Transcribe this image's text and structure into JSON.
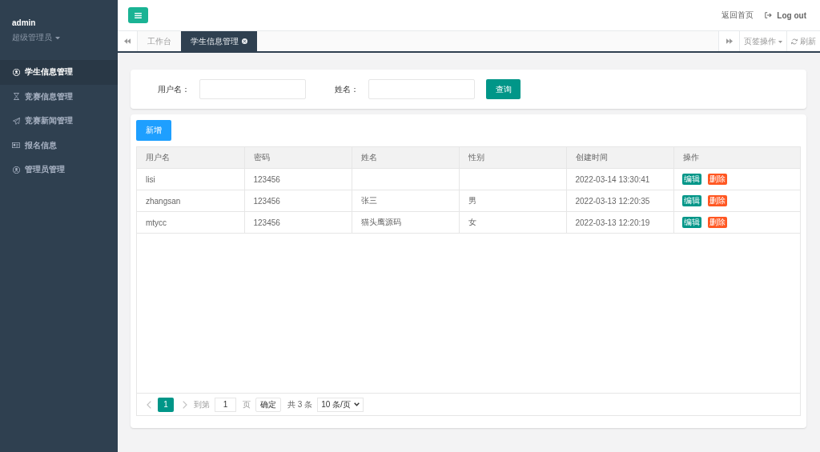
{
  "sidebar": {
    "user_name": "admin",
    "role": "超级管理员",
    "menu": [
      {
        "label": "学生信息管理",
        "selected": true
      },
      {
        "label": "竞赛信息管理",
        "selected": false
      },
      {
        "label": "竞赛新闻管理",
        "selected": false
      },
      {
        "label": "报名信息",
        "selected": false
      },
      {
        "label": "管理员管理",
        "selected": false
      }
    ]
  },
  "topbar": {
    "home_link": "返回首页",
    "logout": "Log out"
  },
  "tabs": {
    "items": [
      {
        "label": "工作台",
        "selected": false,
        "closable": false
      },
      {
        "label": "学生信息管理",
        "selected": true,
        "closable": true
      }
    ],
    "options": "页签操作",
    "refresh": "刷新"
  },
  "search": {
    "fields": [
      {
        "label": "用户名："
      },
      {
        "label": "姓名："
      }
    ],
    "button": "查询"
  },
  "table": {
    "add_button": "新增",
    "columns": [
      "用户名",
      "密码",
      "姓名",
      "性别",
      "创建时间",
      "操作"
    ],
    "rows": [
      {
        "username": "lisi",
        "password": "123456",
        "created_at": "2022-03-14 13:30:41",
        "actions": [
          {
            "label": "编辑",
            "kind": "edit"
          },
          {
            "label": "删除",
            "kind": "delete"
          }
        ]
      },
      {
        "username": "zhangsan",
        "password": "123456",
        "name": "张三",
        "gender": "男",
        "created_at": "2022-03-13 12:20:35",
        "actions": [
          {
            "label": "编辑",
            "kind": "edit"
          },
          {
            "label": "删除",
            "kind": "delete"
          }
        ]
      },
      {
        "username": "mtycc",
        "password": "123456",
        "name": "猫头鹰源码",
        "gender": "女",
        "created_at": "2022-03-13 12:20:19",
        "actions": [
          {
            "label": "编辑",
            "kind": "edit"
          },
          {
            "label": "删除",
            "kind": "delete"
          }
        ]
      }
    ]
  },
  "pagination": {
    "pages": [
      {
        "label": "1",
        "selected": true
      }
    ],
    "goto_label": "到第",
    "goto_value": "1",
    "page_unit": "页",
    "confirm": "确定",
    "total": "共 3 条",
    "page_size": "10 条/页"
  }
}
